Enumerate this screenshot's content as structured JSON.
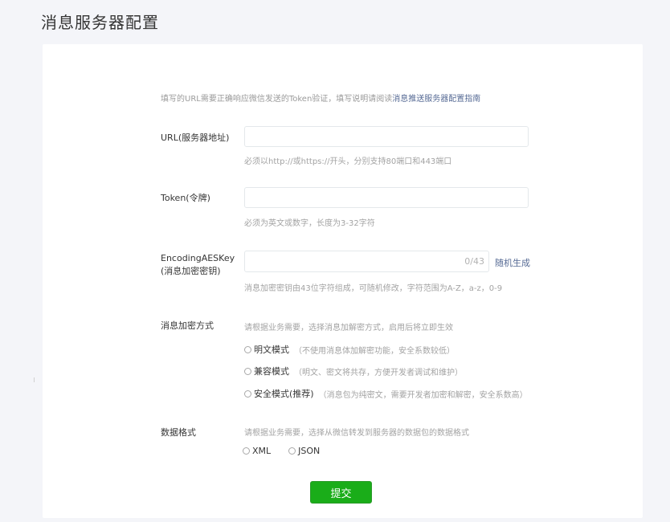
{
  "page": {
    "title": "消息服务器配置"
  },
  "intro": {
    "text": "填写的URL需要正确响应微信发送的Token验证，填写说明请阅读",
    "link": "消息推送服务器配置指南"
  },
  "fields": {
    "url": {
      "label": "URL(服务器地址)",
      "value": "",
      "help": "必须以http://或https://开头，分别支持80端口和443端口"
    },
    "token": {
      "label": "Token(令牌)",
      "value": "",
      "help": "必须为英文或数字，长度为3-32字符"
    },
    "aes": {
      "label_line1": "EncodingAESKey",
      "label_line2": "(消息加密密钥)",
      "counter": "0/43",
      "generate_link": "随机生成",
      "help": "消息加密密钥由43位字符组成，可随机修改，字符范围为A-Z，a-z，0-9"
    }
  },
  "encryption": {
    "label": "消息加密方式",
    "help": "请根据业务需要，选择消息加解密方式，启用后将立即生效",
    "options": [
      {
        "label": "明文模式",
        "desc": "（不使用消息体加解密功能，安全系数较低）"
      },
      {
        "label": "兼容模式",
        "desc": "（明文、密文将共存，方便开发者调试和维护）"
      },
      {
        "label": "安全模式(推荐)",
        "desc": "（消息包为纯密文，需要开发者加密和解密，安全系数高）"
      }
    ]
  },
  "data_format": {
    "label": "数据格式",
    "help": "请根据业务需要，选择从微信转发到服务器的数据包的数据格式",
    "options": [
      {
        "label": "XML"
      },
      {
        "label": "JSON"
      }
    ]
  },
  "submit": {
    "label": "提交"
  },
  "colors": {
    "accent_green": "#1aad19",
    "link_blue": "#576b95",
    "background": "#f4f5f9"
  }
}
